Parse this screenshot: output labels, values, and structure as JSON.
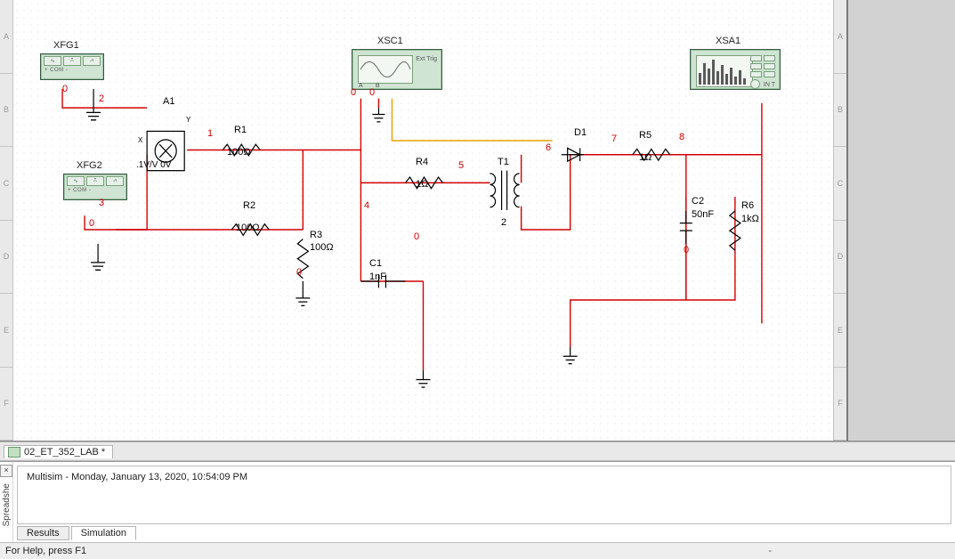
{
  "ruler_labels": [
    "A",
    "B",
    "C",
    "D",
    "E",
    "F"
  ],
  "design_tab": "02_ET_352_LAB *",
  "spreadsheet": {
    "side_label": "Spreadshe",
    "output": "Multisim  -  Monday, January 13, 2020, 10:54:09 PM",
    "tab_results": "Results",
    "tab_simulation": "Simulation"
  },
  "status": {
    "left": "For Help, press F1",
    "right": "-"
  },
  "instruments": {
    "xfg1": {
      "label": "XFG1",
      "com": "COM"
    },
    "xfg2": {
      "label": "XFG2",
      "com": "COM"
    },
    "xsc1": {
      "label": "XSC1",
      "ext": "Ext Trig",
      "a": "A",
      "b": "B"
    },
    "xsa1": {
      "label": "XSA1",
      "io": "IN   T"
    }
  },
  "components": {
    "A1": {
      "ref": "A1",
      "val": ".1V/V 0V",
      "x_lbl": "X",
      "y_lbl": "Y"
    },
    "R1": {
      "ref": "R1",
      "val": "100Ω"
    },
    "R2": {
      "ref": "R2",
      "val": "100Ω"
    },
    "R3": {
      "ref": "R3",
      "val": "100Ω"
    },
    "R4": {
      "ref": "R4",
      "val": "1Ω"
    },
    "R5": {
      "ref": "R5",
      "val": "1Ω"
    },
    "R6": {
      "ref": "R6",
      "val": "1kΩ"
    },
    "C1": {
      "ref": "C1",
      "val": "1nF"
    },
    "C2": {
      "ref": "C2",
      "val": "50nF"
    },
    "T1": {
      "ref": "T1",
      "sec": "2"
    },
    "D1": {
      "ref": "D1"
    }
  },
  "nets": {
    "n0": "0",
    "n1": "1",
    "n2": "2",
    "n3": "3",
    "n4": "4",
    "n5": "5",
    "n6": "6",
    "n7": "7",
    "n8": "8"
  }
}
